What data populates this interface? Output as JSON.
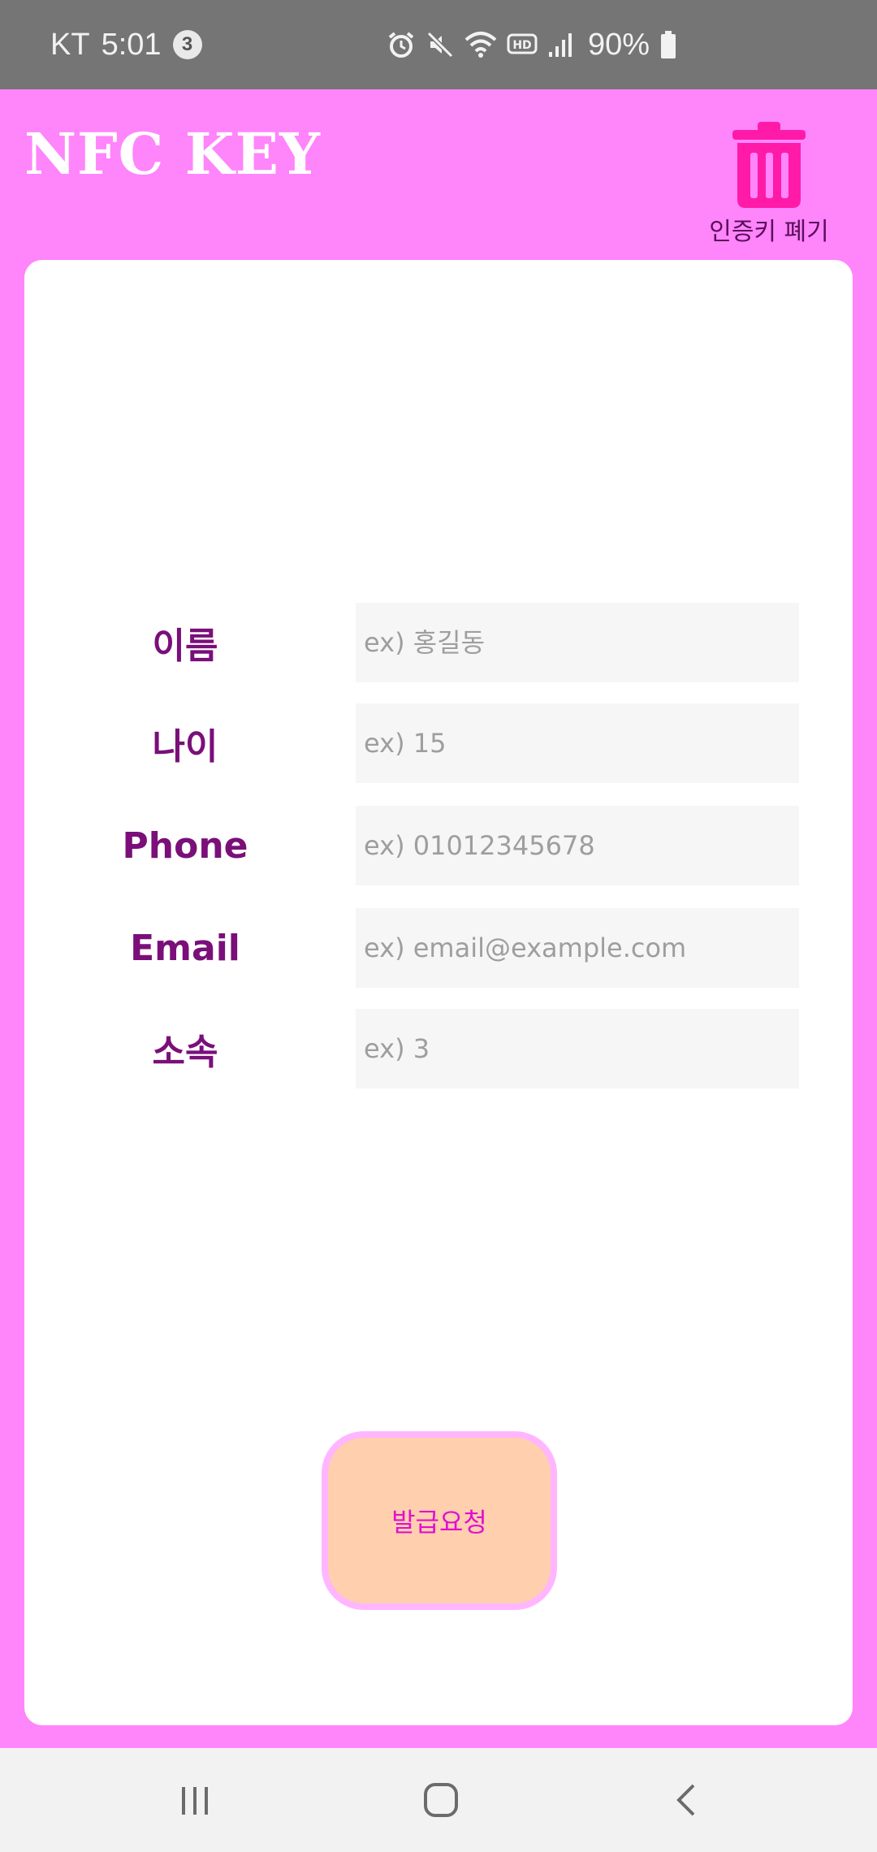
{
  "status_bar": {
    "carrier": "KT",
    "time": "5:01",
    "notification_count": "3",
    "battery": "90%"
  },
  "header": {
    "title": "NFC KEY",
    "discard_label": "인증키 폐기"
  },
  "form": {
    "fields": [
      {
        "label": "이름",
        "placeholder": "ex) 홍길동"
      },
      {
        "label": "나이",
        "placeholder": "ex) 15"
      },
      {
        "label": "Phone",
        "placeholder": "ex) 01012345678"
      },
      {
        "label": "Email",
        "placeholder": "ex) email@example.com"
      },
      {
        "label": "소속",
        "placeholder": "ex) 3"
      }
    ],
    "submit_label": "발급요청"
  },
  "colors": {
    "background": "#ff85fb",
    "label": "#7a0f7a",
    "trash_icon": "#ff1aa8",
    "button_fill": "#ffcfae",
    "button_border": "#ffb6ff",
    "button_text": "#e010d0"
  },
  "icons": {
    "discard": "trash-icon",
    "nav": [
      "recent-apps-icon",
      "home-icon",
      "back-icon"
    ]
  }
}
